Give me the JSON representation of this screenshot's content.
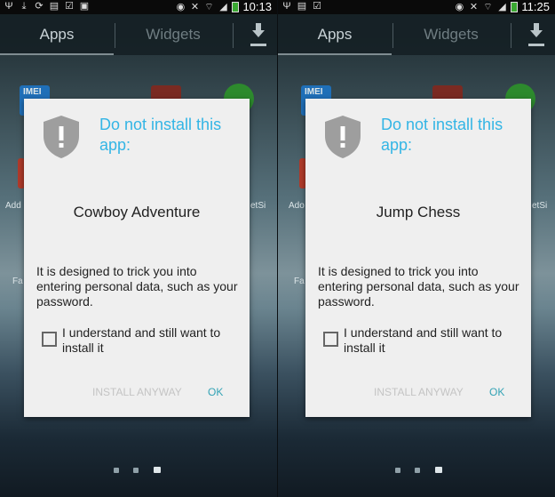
{
  "panels": [
    {
      "status": {
        "time": "10:13"
      },
      "tabs": {
        "apps": "Apps",
        "widgets": "Widgets"
      },
      "background_labels": {
        "imei": "IMEI",
        "row2_left": "Add",
        "row2_right": "etSi",
        "row3_left": "Fa"
      },
      "dialog": {
        "title": "Do not install this app:",
        "app_name": "Cowboy Adventure",
        "message": "It is designed to trick you into entering personal data, such as your password.",
        "checkbox_label": "I understand and still want to install it",
        "checkbox_checked": false,
        "install_button": "INSTALL ANYWAY",
        "ok_button": "OK"
      },
      "page_indicator": {
        "count": 3,
        "active": 3
      }
    },
    {
      "status": {
        "time": "11:25"
      },
      "tabs": {
        "apps": "Apps",
        "widgets": "Widgets"
      },
      "background_labels": {
        "imei": "IMEI",
        "row2_left": "Ado",
        "row2_right": "etSi",
        "row3_left": "Fa"
      },
      "dialog": {
        "title": "Do not install this app:",
        "app_name": "Jump Chess",
        "message": "It is designed to trick you into entering personal data, such as your password.",
        "checkbox_label": "I understand and still want to install it",
        "checkbox_checked": false,
        "install_button": "INSTALL ANYWAY",
        "ok_button": "OK"
      },
      "page_indicator": {
        "count": 3,
        "active": 3
      }
    }
  ],
  "colors": {
    "accent_title": "#33b5e5",
    "ok_button": "#33a3b5",
    "disabled_button": "#c4c4c4",
    "shield": "#9e9e9e",
    "battery": "#3aa832"
  },
  "icons": [
    "usb-icon",
    "download-icon",
    "sync-icon",
    "file-icon",
    "checkbox-icon",
    "image-icon",
    "eye-icon",
    "mute-icon",
    "wifi-icon",
    "signal-icon",
    "battery-icon",
    "shield-warning-icon"
  ]
}
